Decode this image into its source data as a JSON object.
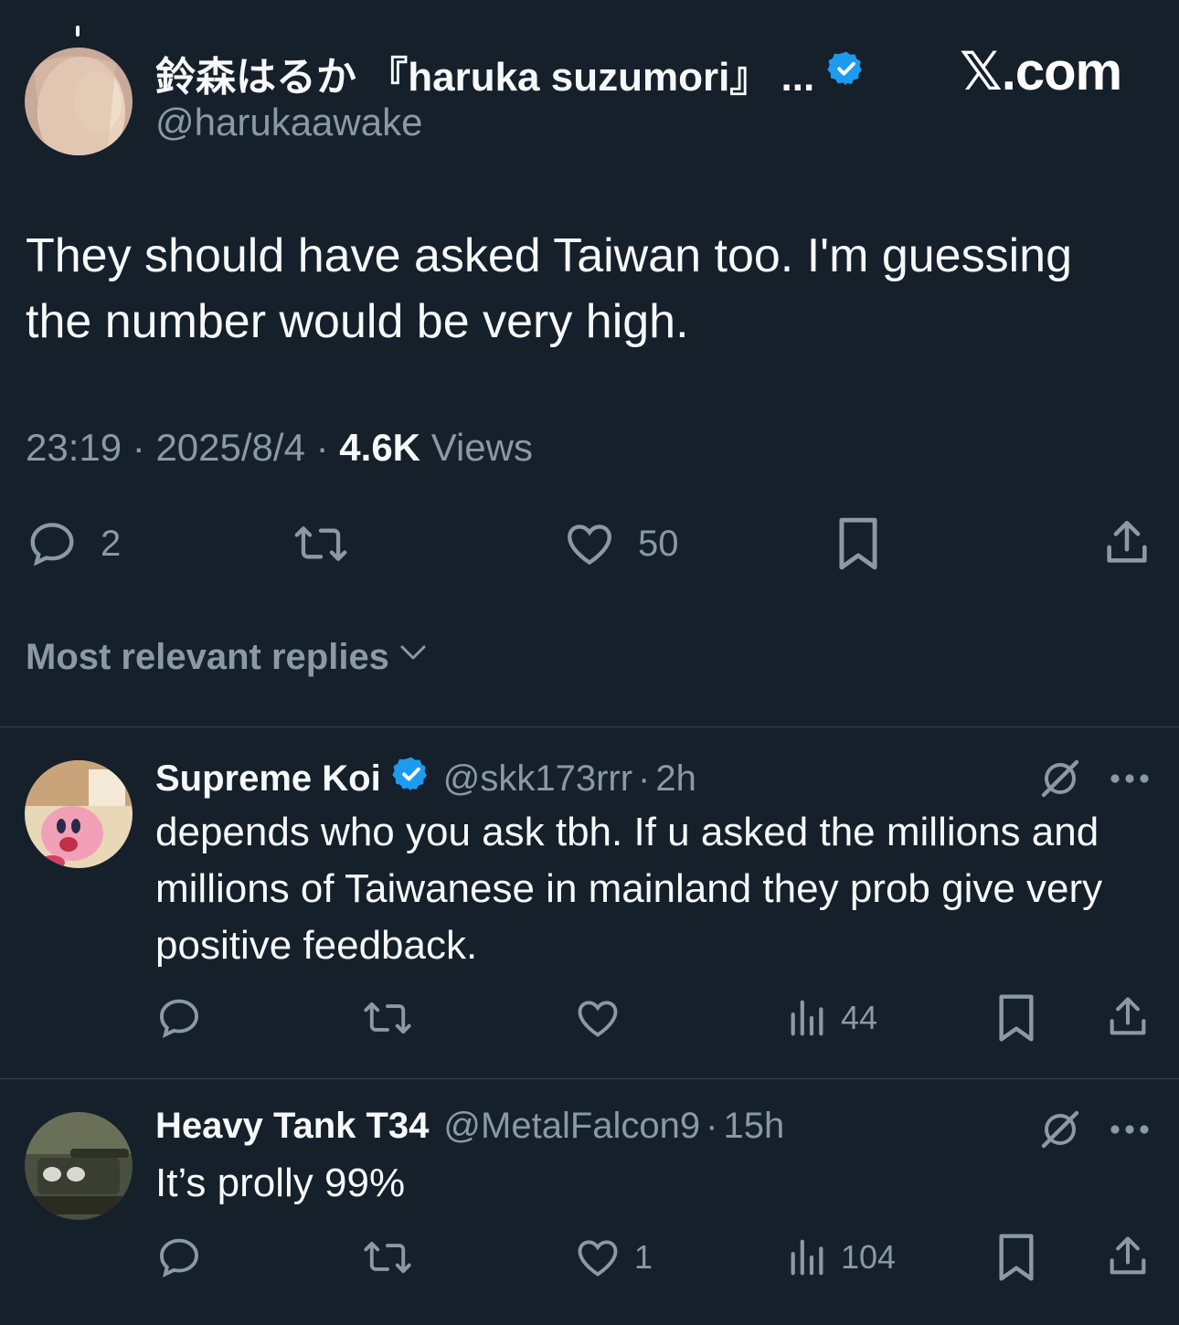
{
  "site_logo": "𝕏.com",
  "tweet": {
    "author_name": "鈴森はるか 『haruka suzumori』 ...",
    "author_handle": "@harukaawake",
    "verified": true,
    "text": "They should have asked Taiwan too. I'm guessing the number would be very high.",
    "time": "23:19",
    "date": "2025/8/4",
    "views_count": "4.6K",
    "views_label": "Views",
    "replies_count": "2",
    "likes_count": "50"
  },
  "replies_sort_label": "Most relevant replies",
  "replies": [
    {
      "author_name": "Supreme Koi",
      "author_handle": "@skk173rrr",
      "time_ago": "2h",
      "verified": true,
      "text": "depends who you ask tbh. If u asked the millions and millions of Taiwanese in mainland they prob give very positive feedback.",
      "likes_count": "",
      "views_count": "44"
    },
    {
      "author_name": "Heavy Tank T34",
      "author_handle": "@MetalFalcon9",
      "time_ago": "15h",
      "verified": false,
      "text": "It’s prolly 99%",
      "likes_count": "1",
      "views_count": "104"
    }
  ],
  "separator": "·",
  "colors": {
    "background": "#15202b",
    "text_primary": "#f7f9f9",
    "text_secondary": "#8b98a5",
    "verified_blue": "#1d9bf0",
    "divider": "#38444d"
  },
  "icons": [
    "reply-icon",
    "retweet-icon",
    "like-icon",
    "bookmark-icon",
    "share-icon",
    "views-icon",
    "grok-icon",
    "more-icon",
    "verified-badge-icon",
    "chevron-down-icon"
  ]
}
